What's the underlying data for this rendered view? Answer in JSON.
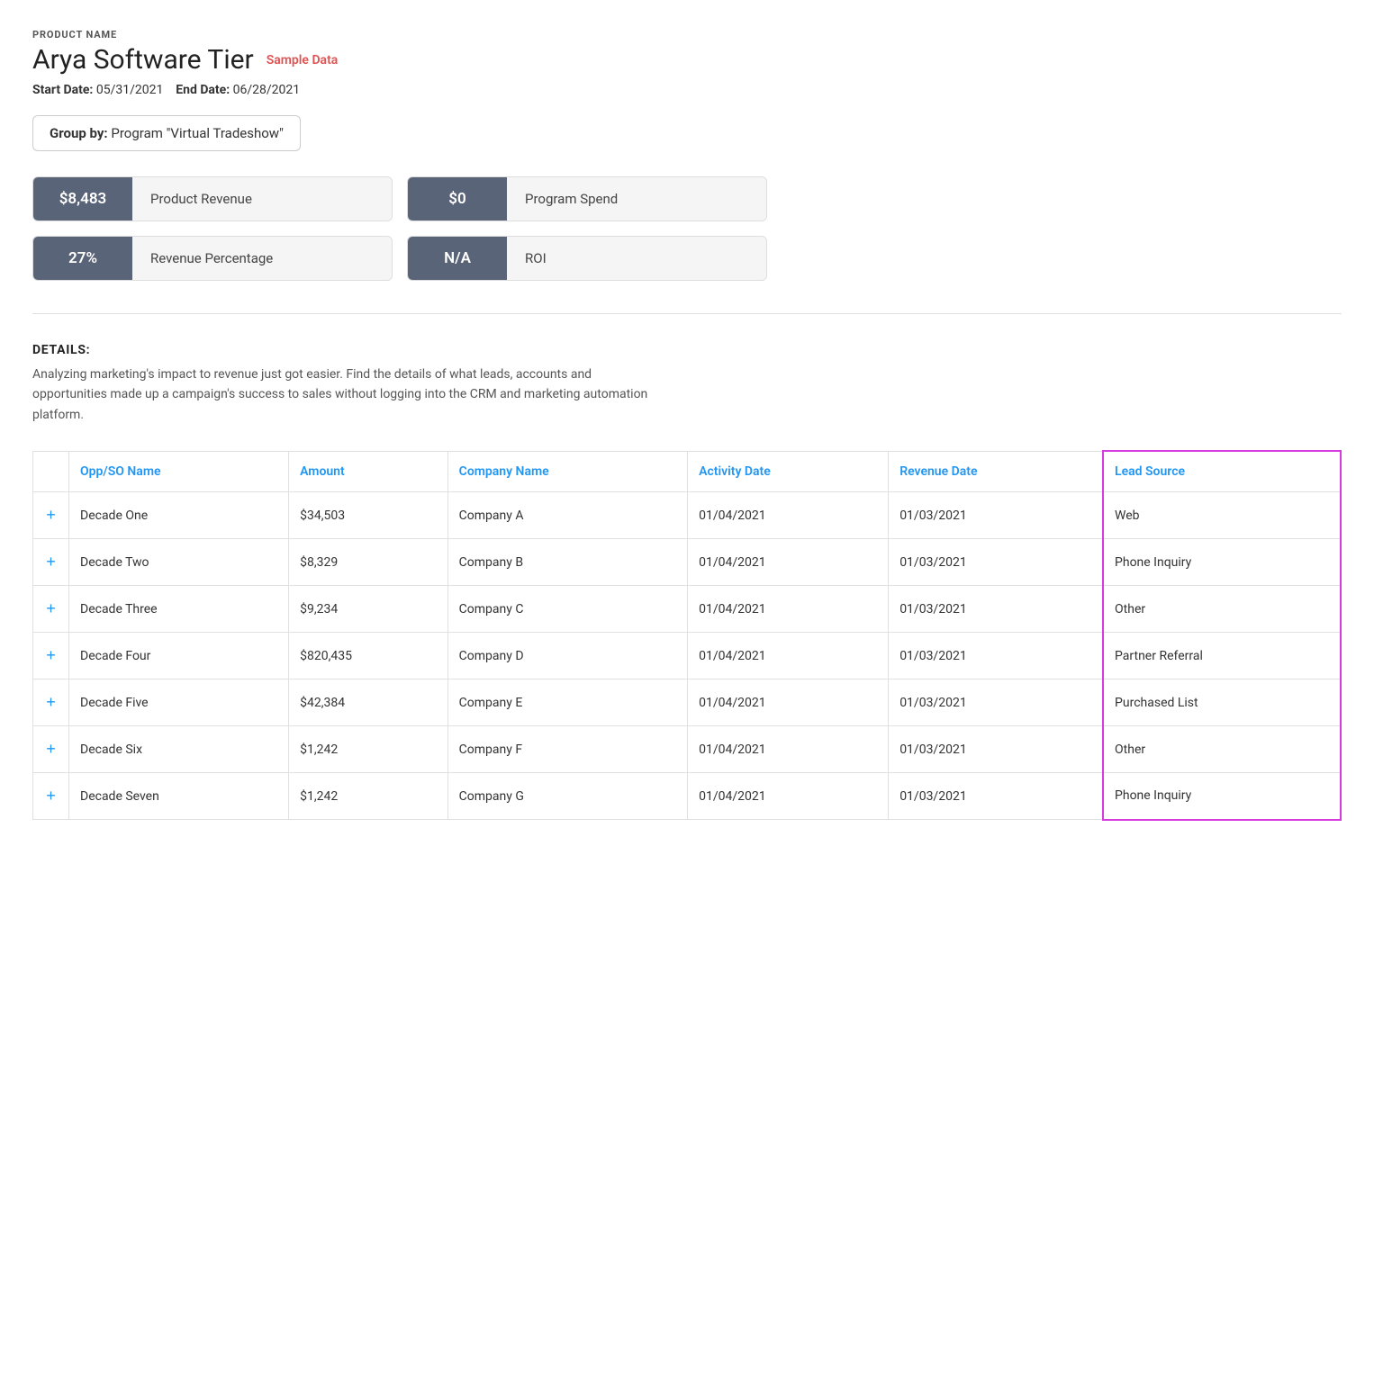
{
  "header": {
    "product_name_label": "PRODUCT NAME",
    "product_title": "Arya Software Tier",
    "sample_data": "Sample Data",
    "start_date_label": "Start Date:",
    "start_date": "05/31/2021",
    "end_date_label": "End Date:",
    "end_date": "06/28/2021",
    "group_by_label": "Group by:",
    "group_by_value": "Program \"Virtual Tradeshow\""
  },
  "metrics": [
    {
      "value": "$8,483",
      "label": "Product Revenue"
    },
    {
      "value": "$0",
      "label": "Program Spend"
    },
    {
      "value": "27%",
      "label": "Revenue Percentage"
    },
    {
      "value": "N/A",
      "label": "ROI"
    }
  ],
  "details": {
    "title": "DETAILS:",
    "text": "Analyzing marketing's impact to revenue just got easier. Find the details of what leads, accounts and opportunities made up a campaign's success to sales without logging into the CRM and marketing automation platform."
  },
  "table": {
    "columns": [
      {
        "key": "expand",
        "label": ""
      },
      {
        "key": "opp_so_name",
        "label": "Opp/SO Name"
      },
      {
        "key": "amount",
        "label": "Amount"
      },
      {
        "key": "company_name",
        "label": "Company Name"
      },
      {
        "key": "activity_date",
        "label": "Activity Date"
      },
      {
        "key": "revenue_date",
        "label": "Revenue Date"
      },
      {
        "key": "lead_source",
        "label": "Lead Source"
      }
    ],
    "rows": [
      {
        "expand": "+",
        "opp_so_name": "Decade One",
        "amount": "$34,503",
        "company_name": "Company A",
        "activity_date": "01/04/2021",
        "revenue_date": "01/03/2021",
        "lead_source": "Web"
      },
      {
        "expand": "+",
        "opp_so_name": "Decade Two",
        "amount": "$8,329",
        "company_name": "Company B",
        "activity_date": "01/04/2021",
        "revenue_date": "01/03/2021",
        "lead_source": "Phone Inquiry"
      },
      {
        "expand": "+",
        "opp_so_name": "Decade Three",
        "amount": "$9,234",
        "company_name": "Company C",
        "activity_date": "01/04/2021",
        "revenue_date": "01/03/2021",
        "lead_source": "Other"
      },
      {
        "expand": "+",
        "opp_so_name": "Decade Four",
        "amount": "$820,435",
        "company_name": "Company D",
        "activity_date": "01/04/2021",
        "revenue_date": "01/03/2021",
        "lead_source": "Partner Referral"
      },
      {
        "expand": "+",
        "opp_so_name": "Decade Five",
        "amount": "$42,384",
        "company_name": "Company E",
        "activity_date": "01/04/2021",
        "revenue_date": "01/03/2021",
        "lead_source": "Purchased List"
      },
      {
        "expand": "+",
        "opp_so_name": "Decade Six",
        "amount": "$1,242",
        "company_name": "Company F",
        "activity_date": "01/04/2021",
        "revenue_date": "01/03/2021",
        "lead_source": "Other"
      },
      {
        "expand": "+",
        "opp_so_name": "Decade Seven",
        "amount": "$1,242",
        "company_name": "Company G",
        "activity_date": "01/04/2021",
        "revenue_date": "01/03/2021",
        "lead_source": "Phone Inquiry"
      }
    ]
  },
  "colors": {
    "metric_bg": "#5a6478",
    "accent_blue": "#2196f3",
    "highlight_pink": "#d63bde",
    "sample_data_red": "#e05252"
  }
}
